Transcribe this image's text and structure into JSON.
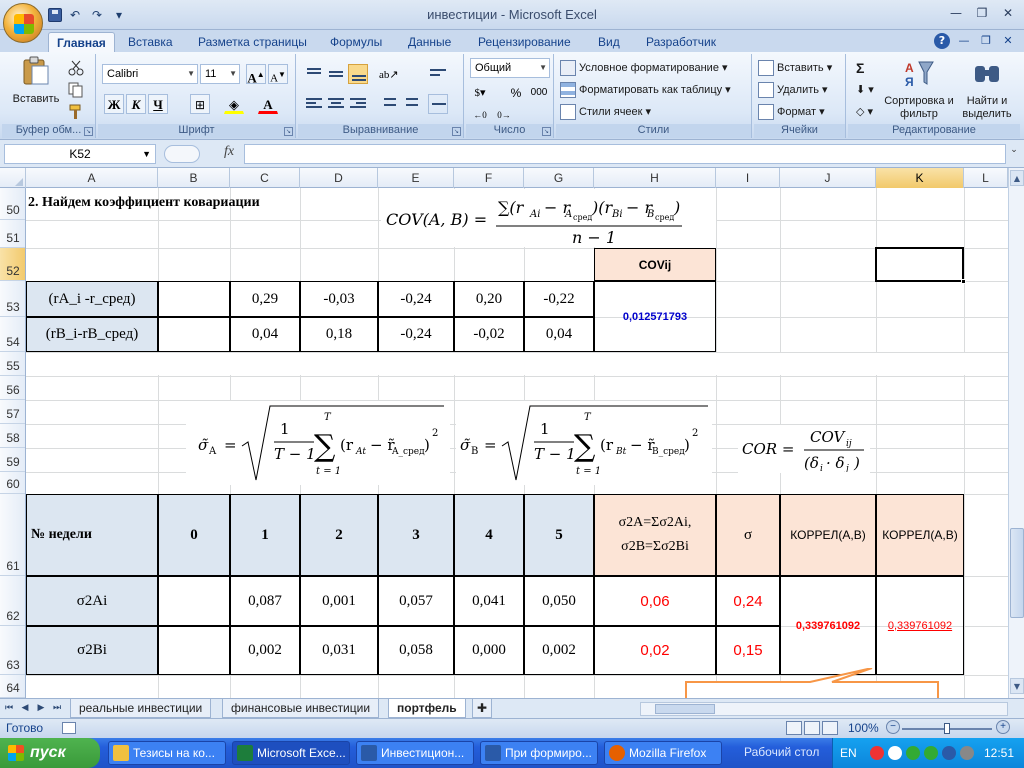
{
  "window": {
    "title": "инвестиции - Microsoft Excel"
  },
  "ribbon_tabs": [
    "Главная",
    "Вставка",
    "Разметка страницы",
    "Формулы",
    "Данные",
    "Рецензирование",
    "Вид",
    "Разработчик"
  ],
  "ribbon": {
    "clipboard": {
      "paste": "Вставить",
      "label": "Буфер обм..."
    },
    "font": {
      "name": "Calibri",
      "size": "11",
      "bold": "Ж",
      "italic": "К",
      "underline": "Ч",
      "label": "Шрифт"
    },
    "alignment": {
      "label": "Выравнивание"
    },
    "number": {
      "format": "Общий",
      "percent": "%",
      "thousands": "000",
      "label": "Число"
    },
    "styles": {
      "conditional": "Условное форматирование",
      "as_table": "Форматировать как таблицу",
      "cell_styles": "Стили ячеек",
      "label": "Стили"
    },
    "cells": {
      "insert": "Вставить",
      "delete": "Удалить",
      "format": "Формат",
      "label": "Ячейки"
    },
    "editing": {
      "sigma": "Σ",
      "sort": "Сортировка и фильтр",
      "find": "Найти и выделить",
      "label": "Редактирование"
    }
  },
  "formula_bar": {
    "name_box": "K52",
    "fx": "fx",
    "value": ""
  },
  "columns": [
    "A",
    "B",
    "C",
    "D",
    "E",
    "F",
    "G",
    "H",
    "I",
    "J",
    "K",
    "L"
  ],
  "rows": [
    "50",
    "51",
    "52",
    "53",
    "54",
    "55",
    "56",
    "57",
    "58",
    "59",
    "60",
    "61",
    "62",
    "63",
    "64"
  ],
  "sheet": {
    "heading": "2. Найдем коэффициент ковариации",
    "cov_header": "COVij",
    "row53": {
      "label": "(rA_i -r_сред)",
      "values": [
        "0,29",
        "-0,03",
        "-0,24",
        "0,20",
        "-0,22"
      ]
    },
    "row54": {
      "label": "(rB_i-rB_сред)",
      "values": [
        "0,04",
        "0,18",
        "-0,24",
        "-0,02",
        "0,04"
      ]
    },
    "cov_value": "0,012571793",
    "table_header": {
      "week": "№ недели",
      "weeks": [
        "0",
        "1",
        "2",
        "3",
        "4",
        "5"
      ],
      "sum": "σ2A=Σσ2Ai, σ2B=Σσ2Bi",
      "sigma": "σ",
      "correl1": "КОРРЕЛ(A,B)",
      "correl2": "КОРРЕЛ(A,B)"
    },
    "row62": {
      "label": "σ2Ai",
      "values": [
        "",
        "0,087",
        "0,001",
        "0,057",
        "0,041",
        "0,050"
      ],
      "sum": "0,06",
      "sigma": "0,24"
    },
    "row63": {
      "label": "σ2Bi",
      "values": [
        "",
        "0,002",
        "0,031",
        "0,058",
        "0,000",
        "0,002"
      ],
      "sum": "0,02",
      "sigma": "0,15"
    },
    "correl_value_1": "0,339761092",
    "correl_value_2": "0,339761092"
  },
  "sheet_tabs": [
    "реальные инвестиции",
    "финансовые инвестиции",
    "портфель"
  ],
  "status": {
    "ready": "Готово",
    "zoom": "100%"
  },
  "taskbar": {
    "start": "пуск",
    "tasks": [
      "Тезисы на ко...",
      "Microsoft Exce...",
      "Инвестицион...",
      "При формиро...",
      "Mozilla Firefox"
    ],
    "desktop": "Рабочий стол",
    "lang": "EN",
    "clock": "12:51"
  },
  "colors": {
    "accent": "#15428b",
    "header_fill": "#fce4d6",
    "label_fill": "#dce6f1",
    "red": "#ff0000",
    "blue": "#0000cc"
  }
}
